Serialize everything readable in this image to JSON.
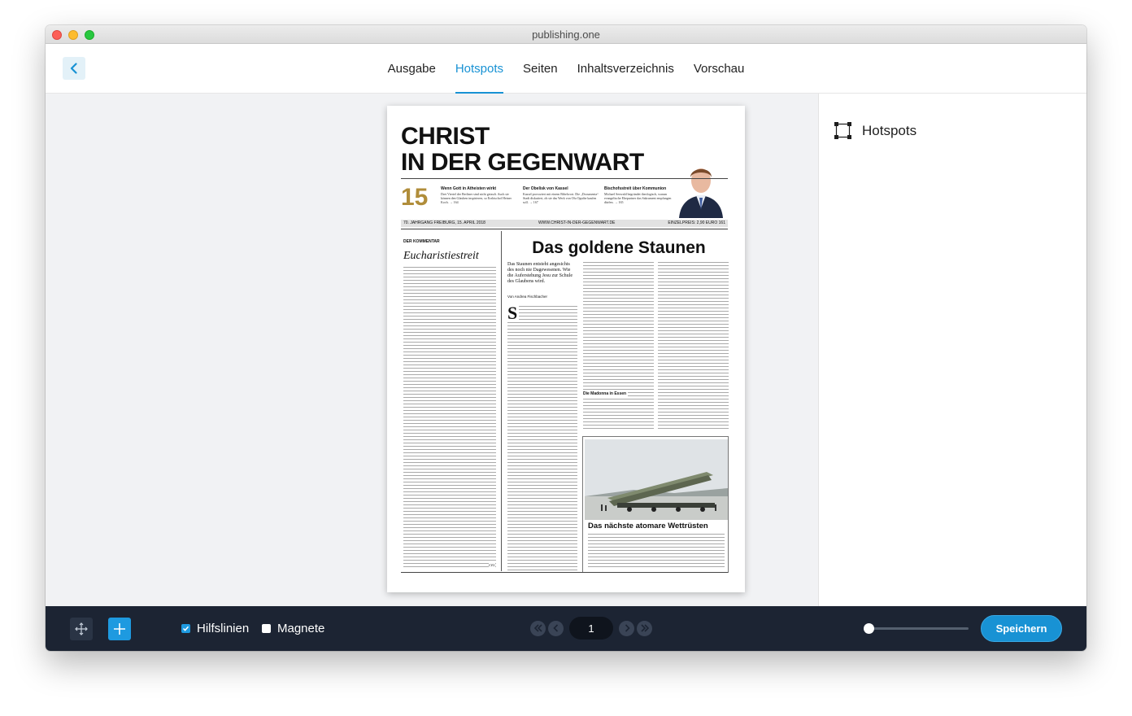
{
  "window": {
    "title": "publishing.one"
  },
  "nav": {
    "tabs": [
      {
        "label": "Ausgabe",
        "active": false
      },
      {
        "label": "Hotspots",
        "active": true
      },
      {
        "label": "Seiten",
        "active": false
      },
      {
        "label": "Inhaltsverzeichnis",
        "active": false
      },
      {
        "label": "Vorschau",
        "active": false
      }
    ]
  },
  "panel": {
    "hotspots_label": "Hotspots"
  },
  "page": {
    "masthead_line1": "CHRIST",
    "masthead_line2": "IN DER GEGENWART",
    "issue_number": "15",
    "teasers": [
      {
        "title": "Wenn Gott in Atheisten wirkt",
        "text": "Drei Viertel der Berliner sind nicht getauft. Auch sie können den Glauben inspirieren, so Erzbischof Heiner Koch. → 164"
      },
      {
        "title": "Der Obelisk von Kassel",
        "text": "Kassel provoziert mit einem Bibelwort. Die „Documenta“ Stadt diskutiert, ob sie das Werk von Olu Oguibe kaufen soll. → 167"
      },
      {
        "title": "Bischofsstreit über Kommunion",
        "text": "Michael Seewald begründet theologisch, warum evangelische Ehepartner das Sakrament empfangen dürfen. → 165"
      }
    ],
    "dateline_left": "70. JAHRGANG  FREIBURG, 15. APRIL 2018",
    "dateline_center": "WWW.CHRIST-IN-DER-GEGENWART.DE",
    "dateline_right": "EINZELPREIS: 2,90 EURO  161",
    "kommentar_label": "DER KOMMENTAR",
    "kommentar_title": "Eucharistiestreit",
    "headline": "Das goldene Staunen",
    "lead": "Das Staunen entsteht angesichts des noch nie Dagewesenen. Wie die Auferstehung Jesu zur Schule des Glaubens wird.",
    "byline": "Von Andrea Fischbacher",
    "dropcap": "S",
    "cig": "CIG",
    "subhead": "Die Madonna in Essen",
    "photo_title": "Das nächste atomare Wettrüsten"
  },
  "toolbar": {
    "hilfslinien_label": "Hilfslinien",
    "hilfslinien_checked": true,
    "magnete_label": "Magnete",
    "magnete_checked": false,
    "page_number": "1",
    "zoom_level": 0,
    "save_label": "Speichern"
  },
  "colors": {
    "accent": "#1892d4",
    "bottombar": "#1c2433",
    "canvas": "#f1f2f4"
  }
}
